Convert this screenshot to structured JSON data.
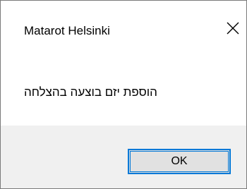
{
  "window": {
    "title": "Matarot Helsinki",
    "close_icon": "close-icon"
  },
  "message": {
    "text": "הוספת  יזם בוצעה בהצלחה"
  },
  "buttons": {
    "ok_label": "OK"
  },
  "colors": {
    "dialog_background": "#ffffff",
    "footer_background": "#f0f0f0",
    "button_background": "#e1e1e1",
    "button_focus_border": "#0078d7",
    "window_border": "#7a7a7a"
  }
}
